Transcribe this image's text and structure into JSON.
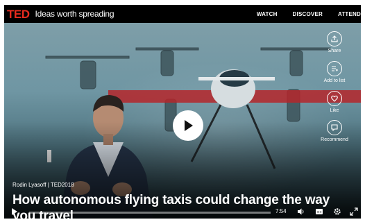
{
  "header": {
    "logo": "TED",
    "tagline": "Ideas worth spreading",
    "nav": [
      "WATCH",
      "DISCOVER",
      "ATTEND"
    ]
  },
  "side_actions": [
    {
      "icon": "share-icon",
      "label": "Share"
    },
    {
      "icon": "add-to-list-icon",
      "label": "Add to list"
    },
    {
      "icon": "heart-icon",
      "label": "Like"
    },
    {
      "icon": "recommend-icon",
      "label": "Recommend"
    }
  ],
  "video": {
    "speaker": "Rodin Lyasoff | TED2018",
    "title": "How autonomous flying taxis could change the way you travel",
    "duration": "7:54",
    "progress": 0.0
  },
  "controls": {
    "icons": [
      "play-icon",
      "volume-icon",
      "subtitles-icon",
      "settings-icon",
      "fullscreen-icon"
    ]
  },
  "colors": {
    "brand_red": "#e62b1e",
    "bar_bg": "#000000"
  }
}
